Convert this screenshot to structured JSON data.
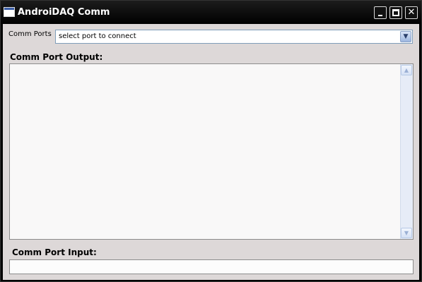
{
  "window": {
    "title": "AndroiDAQ Comm",
    "controls": {
      "minimize_icon": "minimize-icon",
      "maximize_icon": "maximize-icon",
      "close_glyph": "✕"
    }
  },
  "comm_ports": {
    "label": "Comm Ports",
    "selected": "select port to connect",
    "dropdown_glyph": "▼"
  },
  "output": {
    "label": "Comm Port Output:",
    "text": "",
    "scroll_up_glyph": "▲",
    "scroll_down_glyph": "▼"
  },
  "input": {
    "label": "Comm Port Input:",
    "value": ""
  }
}
